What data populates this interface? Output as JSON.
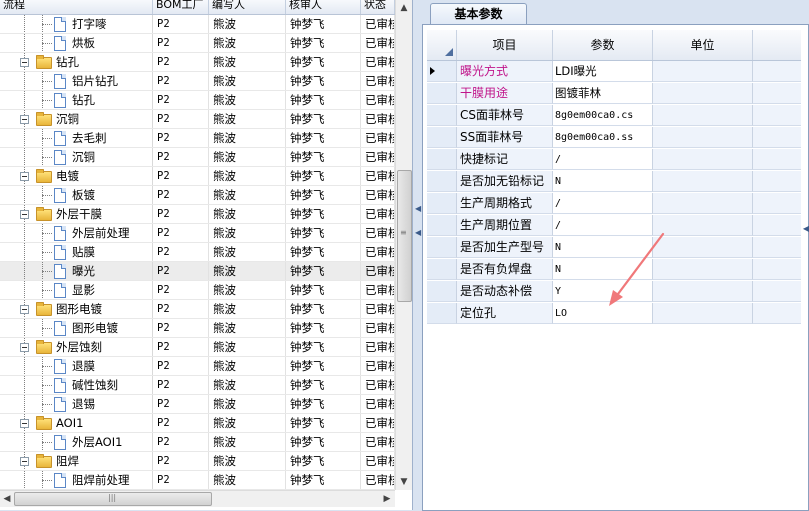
{
  "left_grid": {
    "columns": [
      "流程",
      "BOM工厂",
      "编写人",
      "核审人",
      "状态"
    ],
    "rows": [
      {
        "name": "打字嘜",
        "level": 2,
        "type": "doc",
        "bom": "P2",
        "editor": "熊波",
        "auditor": "钟梦飞",
        "status": "已审核"
      },
      {
        "name": "烘板",
        "level": 2,
        "type": "doc",
        "bom": "P2",
        "editor": "熊波",
        "auditor": "钟梦飞",
        "status": "已审核"
      },
      {
        "name": "钻孔",
        "level": 1,
        "type": "folder",
        "bom": "P2",
        "editor": "熊波",
        "auditor": "钟梦飞",
        "status": "已审核"
      },
      {
        "name": "铝片钻孔",
        "level": 2,
        "type": "doc",
        "bom": "P2",
        "editor": "熊波",
        "auditor": "钟梦飞",
        "status": "已审核"
      },
      {
        "name": "钻孔",
        "level": 2,
        "type": "doc",
        "bom": "P2",
        "editor": "熊波",
        "auditor": "钟梦飞",
        "status": "已审核"
      },
      {
        "name": "沉铜",
        "level": 1,
        "type": "folder",
        "bom": "P2",
        "editor": "熊波",
        "auditor": "钟梦飞",
        "status": "已审核"
      },
      {
        "name": "去毛刺",
        "level": 2,
        "type": "doc",
        "bom": "P2",
        "editor": "熊波",
        "auditor": "钟梦飞",
        "status": "已审核"
      },
      {
        "name": "沉铜",
        "level": 2,
        "type": "doc",
        "bom": "P2",
        "editor": "熊波",
        "auditor": "钟梦飞",
        "status": "已审核"
      },
      {
        "name": "电镀",
        "level": 1,
        "type": "folder",
        "bom": "P2",
        "editor": "熊波",
        "auditor": "钟梦飞",
        "status": "已审核"
      },
      {
        "name": "板镀",
        "level": 2,
        "type": "doc",
        "bom": "P2",
        "editor": "熊波",
        "auditor": "钟梦飞",
        "status": "已审核"
      },
      {
        "name": "外层干膜",
        "level": 1,
        "type": "folder",
        "bom": "P2",
        "editor": "熊波",
        "auditor": "钟梦飞",
        "status": "已审核"
      },
      {
        "name": "外层前处理",
        "level": 2,
        "type": "doc",
        "bom": "P2",
        "editor": "熊波",
        "auditor": "钟梦飞",
        "status": "已审核"
      },
      {
        "name": "贴膜",
        "level": 2,
        "type": "doc",
        "bom": "P2",
        "editor": "熊波",
        "auditor": "钟梦飞",
        "status": "已审核"
      },
      {
        "name": "曝光",
        "level": 2,
        "type": "doc",
        "bom": "P2",
        "editor": "熊波",
        "auditor": "钟梦飞",
        "status": "已审核",
        "selected": true
      },
      {
        "name": "显影",
        "level": 2,
        "type": "doc",
        "bom": "P2",
        "editor": "熊波",
        "auditor": "钟梦飞",
        "status": "已审核"
      },
      {
        "name": "图形电镀",
        "level": 1,
        "type": "folder",
        "bom": "P2",
        "editor": "熊波",
        "auditor": "钟梦飞",
        "status": "已审核"
      },
      {
        "name": "图形电镀",
        "level": 2,
        "type": "doc",
        "bom": "P2",
        "editor": "熊波",
        "auditor": "钟梦飞",
        "status": "已审核"
      },
      {
        "name": "外层蚀刻",
        "level": 1,
        "type": "folder",
        "bom": "P2",
        "editor": "熊波",
        "auditor": "钟梦飞",
        "status": "已审核"
      },
      {
        "name": "退膜",
        "level": 2,
        "type": "doc",
        "bom": "P2",
        "editor": "熊波",
        "auditor": "钟梦飞",
        "status": "已审核"
      },
      {
        "name": "碱性蚀刻",
        "level": 2,
        "type": "doc",
        "bom": "P2",
        "editor": "熊波",
        "auditor": "钟梦飞",
        "status": "已审核"
      },
      {
        "name": "退锡",
        "level": 2,
        "type": "doc",
        "bom": "P2",
        "editor": "熊波",
        "auditor": "钟梦飞",
        "status": "已审核"
      },
      {
        "name": "AOI1",
        "level": 1,
        "type": "folder",
        "bom": "P2",
        "editor": "熊波",
        "auditor": "钟梦飞",
        "status": "已审核"
      },
      {
        "name": "外层AOI1",
        "level": 2,
        "type": "doc",
        "bom": "P2",
        "editor": "熊波",
        "auditor": "钟梦飞",
        "status": "已审核"
      },
      {
        "name": "阻焊",
        "level": 1,
        "type": "folder",
        "bom": "P2",
        "editor": "熊波",
        "auditor": "钟梦飞",
        "status": "已审核"
      },
      {
        "name": "阻焊前处理",
        "level": 2,
        "type": "doc",
        "bom": "P2",
        "editor": "熊波",
        "auditor": "钟梦飞",
        "status": "已审核"
      }
    ]
  },
  "right_panel": {
    "tab_label": "基本参数",
    "columns": [
      "项目",
      "参数",
      "单位"
    ],
    "params": [
      {
        "key": "曝光方式",
        "value": "LDI曝光",
        "unit": "",
        "highlight": true,
        "current": true
      },
      {
        "key": "干膜用途",
        "value": "图镀菲林",
        "unit": "",
        "highlight": true
      },
      {
        "key": "CS面菲林号",
        "value": "8g0em00ca0.cs",
        "unit": ""
      },
      {
        "key": "SS面菲林号",
        "value": "8g0em00ca0.ss",
        "unit": ""
      },
      {
        "key": "快捷标记",
        "value": "/",
        "unit": ""
      },
      {
        "key": "是否加无铅标记",
        "value": "N",
        "unit": ""
      },
      {
        "key": "生产周期格式",
        "value": "/",
        "unit": ""
      },
      {
        "key": "生产周期位置",
        "value": "/",
        "unit": ""
      },
      {
        "key": "是否加生产型号",
        "value": "N",
        "unit": ""
      },
      {
        "key": "是否有负焊盘",
        "value": "N",
        "unit": ""
      },
      {
        "key": "是否动态补偿",
        "value": "Y",
        "unit": ""
      },
      {
        "key": "定位孔",
        "value": "LO",
        "unit": ""
      }
    ]
  },
  "colors": {
    "accent_magenta": "#c0148a",
    "annotation_arrow": "#f0787a"
  }
}
